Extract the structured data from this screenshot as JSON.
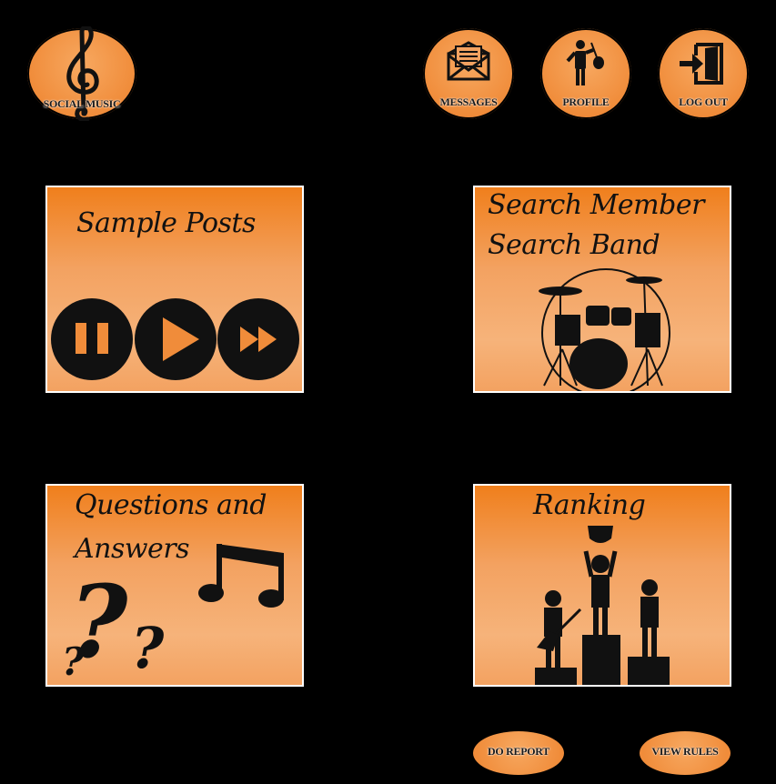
{
  "header": {
    "logo_label": "SOCIAL MUSIC",
    "nav": [
      {
        "label": "MESSAGES",
        "icon": "envelope-icon"
      },
      {
        "label": "PROFILE",
        "icon": "musician-icon"
      },
      {
        "label": "LOG OUT",
        "icon": "logout-icon"
      }
    ]
  },
  "panels": {
    "sample_posts": {
      "title": "Sample Posts",
      "icons": [
        "pause-icon",
        "play-icon",
        "fast-forward-icon"
      ]
    },
    "search": {
      "title_line1": "Search Member",
      "title_line2": "Search Band",
      "icon": "drum-kit-icon"
    },
    "qa": {
      "title_line1": "Questions and",
      "title_line2": "Answers",
      "icons": [
        "question-marks-icon",
        "music-note-icon"
      ]
    },
    "ranking": {
      "title": "Ranking",
      "icon": "podium-icon"
    }
  },
  "footer": {
    "report_label": "DO REPORT",
    "rules_label": "VIEW RULES"
  },
  "colors": {
    "background": "#000000",
    "accent": "#f08c3a",
    "accent_light": "#f6b37a",
    "ink": "#111111"
  }
}
